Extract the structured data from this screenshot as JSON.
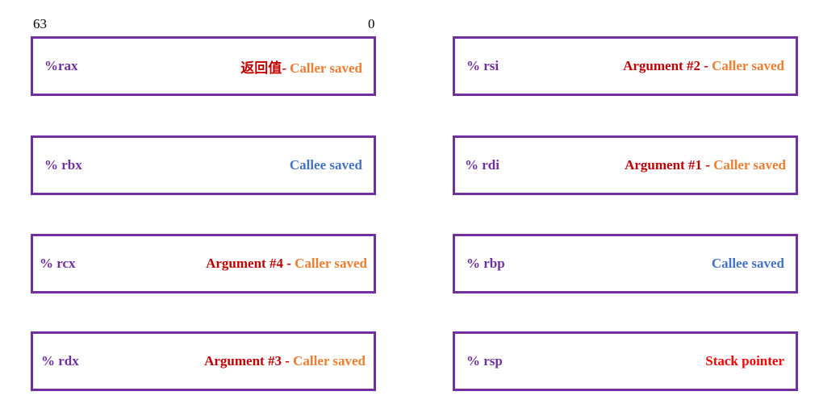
{
  "bits": {
    "high": "63",
    "low": "0"
  },
  "registers": {
    "rax": {
      "name": "%rax",
      "role": "返回值",
      "sep": "- ",
      "save": "Caller saved"
    },
    "rbx": {
      "name": "% rbx",
      "save": "Callee saved"
    },
    "rcx": {
      "name": "% rcx",
      "role": "Argument #4",
      "sep": " - ",
      "save": "Caller saved"
    },
    "rdx": {
      "name": "% rdx",
      "role": "Argument #3",
      "sep": " - ",
      "save": "Caller saved"
    },
    "rsi": {
      "name": "% rsi",
      "role": "Argument #2",
      "sep": " - ",
      "save": "Caller saved"
    },
    "rdi": {
      "name": "% rdi",
      "role": "Argument #1",
      "sep": " - ",
      "save": "Caller saved"
    },
    "rbp": {
      "name": "% rbp",
      "save": "Callee saved"
    },
    "rsp": {
      "name": "% rsp",
      "role": "Stack pointer"
    }
  },
  "colors": {
    "border": "#7030a0",
    "register_name": "#7030a0",
    "role": "#c00000",
    "caller_saved": "#ed7d31",
    "callee_saved": "#4472c4",
    "stack_pointer": "#ff0000"
  }
}
